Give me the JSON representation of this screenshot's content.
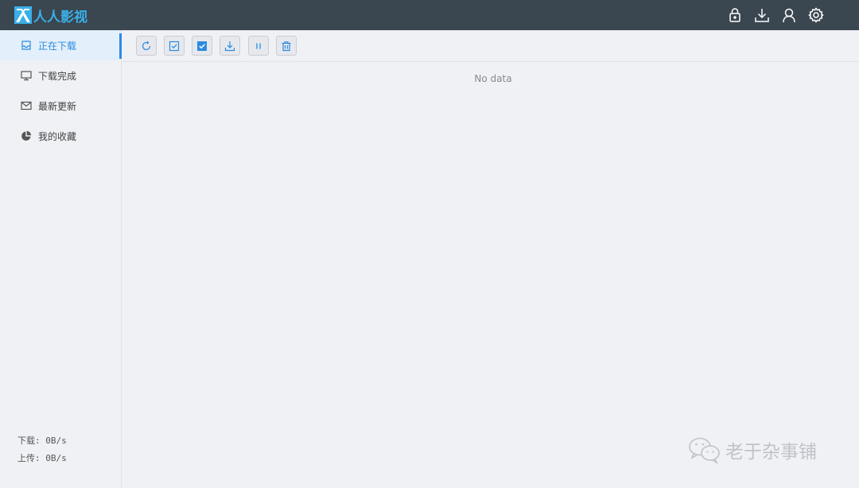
{
  "app": {
    "logo_text": "人人影视"
  },
  "header": {
    "icons": [
      "lock-icon",
      "download-icon",
      "user-icon",
      "settings-icon"
    ]
  },
  "sidebar": {
    "items": [
      {
        "label": "正在下载",
        "icon": "inbox-icon",
        "active": true
      },
      {
        "label": "下载完成",
        "icon": "monitor-icon",
        "active": false
      },
      {
        "label": "最新更新",
        "icon": "mail-icon",
        "active": false
      },
      {
        "label": "我的收藏",
        "icon": "pie-chart-icon",
        "active": false
      }
    ],
    "download_speed": "下载: 0B/s",
    "upload_speed": "上传: 0B/s"
  },
  "toolbar": {
    "buttons": [
      "refresh-icon",
      "check-square-outline-icon",
      "check-square-filled-icon",
      "download-icon",
      "pause-icon",
      "trash-icon"
    ]
  },
  "main": {
    "empty_text": "No data"
  },
  "watermark": {
    "text": "老于杂事铺"
  },
  "colors": {
    "topbar": "#3a4650",
    "accent": "#2a8ce0",
    "active_bg": "#e3effa",
    "background": "#f0f1f5"
  }
}
